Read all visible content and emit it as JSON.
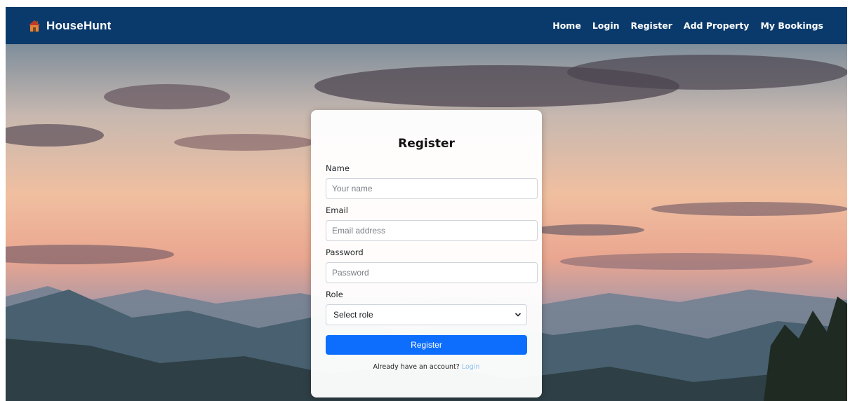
{
  "navbar": {
    "brand": "HouseHunt",
    "brand_icon": "house-icon",
    "links": [
      {
        "label": "Home"
      },
      {
        "label": "Login"
      },
      {
        "label": "Register"
      },
      {
        "label": "Add Property"
      },
      {
        "label": "My Bookings"
      }
    ],
    "background": "#0a3a6b"
  },
  "form": {
    "title": "Register",
    "name_label": "Name",
    "name_placeholder": "Your name",
    "email_label": "Email",
    "email_placeholder": "Email address",
    "password_label": "Password",
    "password_placeholder": "Password",
    "role_label": "Role",
    "role_selected": "Select role",
    "submit_label": "Register",
    "footer_text": "Already have an account?",
    "footer_link": "Login",
    "accent": "#0d6efd"
  }
}
